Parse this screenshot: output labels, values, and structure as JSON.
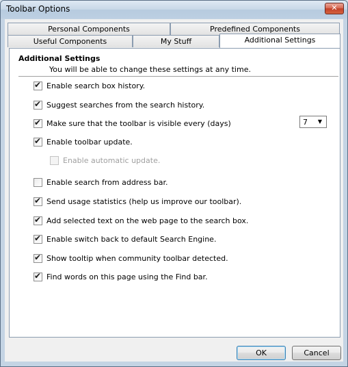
{
  "window": {
    "title": "Toolbar Options",
    "close_symbol": "✕"
  },
  "tabs": {
    "row_back": [
      {
        "label": "Personal Components"
      },
      {
        "label": "Predefined Components"
      }
    ],
    "row_front": [
      {
        "label": "Useful Components"
      },
      {
        "label": "My Stuff"
      },
      {
        "label": "Additional Settings",
        "active": true
      }
    ]
  },
  "settings": {
    "section_title": "Additional Settings",
    "section_desc": "You will be able to change these settings at any time.",
    "options": [
      {
        "label": "Enable search box history.",
        "checked": true,
        "enabled": true
      },
      {
        "label": "Suggest searches from the search history.",
        "checked": true,
        "enabled": true
      },
      {
        "label": "Make sure that the toolbar is visible every (days)",
        "checked": true,
        "enabled": true
      },
      {
        "label": "Enable toolbar update.",
        "checked": true,
        "enabled": true
      },
      {
        "label": "Enable automatic update.",
        "checked": false,
        "enabled": false
      },
      {
        "label": "Enable search from address bar.",
        "checked": false,
        "enabled": true
      },
      {
        "label": "Send usage statistics (help us improve our toolbar).",
        "checked": true,
        "enabled": true
      },
      {
        "label": "Add selected text on the web page to the search box.",
        "checked": true,
        "enabled": true
      },
      {
        "label": "Enable switch back to default Search Engine.",
        "checked": true,
        "enabled": true
      },
      {
        "label": "Show tooltip when community toolbar detected.",
        "checked": true,
        "enabled": true
      },
      {
        "label": "Find words on this page using the Find bar.",
        "checked": true,
        "enabled": true
      }
    ],
    "days_combo": {
      "value": "7",
      "arrow": "▼"
    },
    "check_mark": "✔"
  },
  "buttons": {
    "ok": "OK",
    "cancel": "Cancel"
  }
}
